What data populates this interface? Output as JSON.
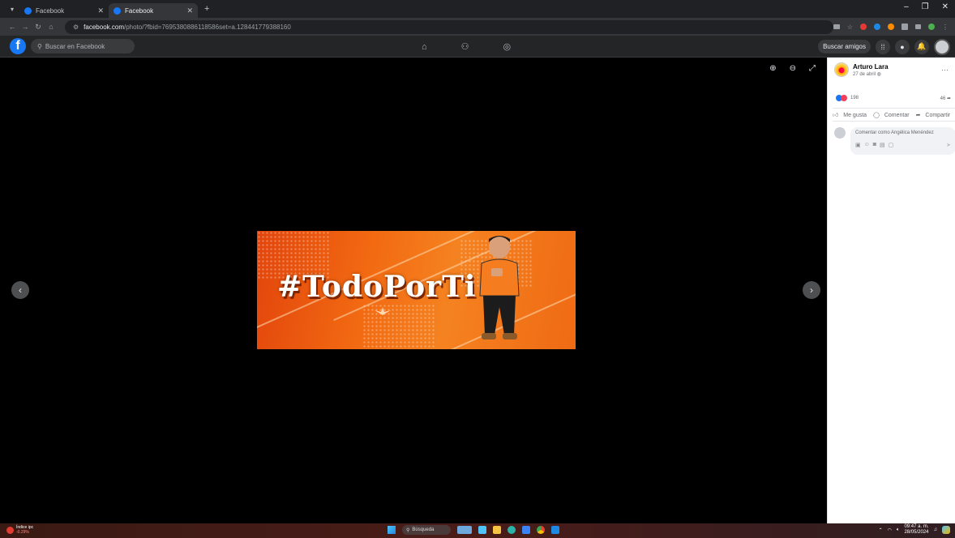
{
  "browser": {
    "tabs": [
      {
        "title": "Facebook",
        "active": false
      },
      {
        "title": "Facebook",
        "active": true
      }
    ],
    "url_host": "facebook.com",
    "url_path": "/photo/?fbid=7695380886118586set=a.128441779388160"
  },
  "facebook": {
    "search_placeholder": "Buscar en Facebook",
    "find_friends_label": "Buscar amigos",
    "brand_color": "#1877f2"
  },
  "photo": {
    "banner_text": "#TodoPorTi"
  },
  "post": {
    "author": "Arturo Lara",
    "date": "27 de abril",
    "reactions_count": "198",
    "shares_count": "46",
    "like_label": "Me gusta",
    "comment_label": "Comentar",
    "share_label": "Compartir",
    "comment_placeholder": "Comentar como Angélica Menéndez"
  },
  "taskbar": {
    "stock_name": "Índice ipc",
    "stock_change": "-0.29%",
    "search_label": "Búsqueda",
    "time": "09:47 a. m.",
    "date": "28/05/2024"
  }
}
